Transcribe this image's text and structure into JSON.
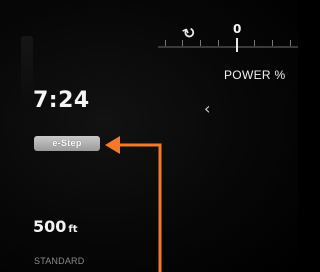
{
  "cluster": {
    "time": "7:24",
    "drive_badge": "e-Step",
    "distance": {
      "value": "500",
      "unit": "ft"
    },
    "mode": "STANDARD"
  },
  "power_meter": {
    "regen_icon": "regen-arrow-icon",
    "zero": "0",
    "title": "POWER %"
  },
  "colors": {
    "arrow": "#f47a2a",
    "badge": "#b3b3b3"
  }
}
